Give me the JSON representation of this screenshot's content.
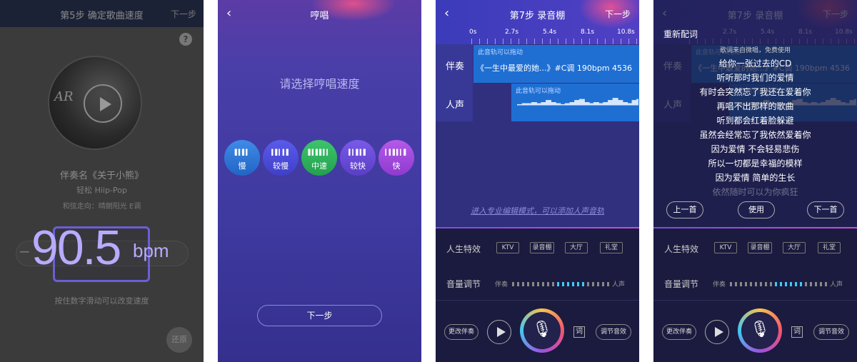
{
  "screen1": {
    "title": "第5步 确定歌曲速度",
    "next": "下一步",
    "help": "?",
    "cover_text": "AR",
    "song_name": "伴奏名《关于小熊》",
    "style": "轻松 Hiip-Pop",
    "chord": "和弦走向：晴朗阳光   E调",
    "bpm_value": "90.5",
    "bpm_unit": "bpm",
    "minus": "−",
    "hint": "按住数字滑动可以改变速度",
    "confirm": "还原"
  },
  "screen2": {
    "title": "哼唱",
    "back_icon": "chevron-left-icon",
    "prompt": "请选择哼唱速度",
    "speeds": [
      {
        "label": "慢",
        "colors": [
          "#3f8be8",
          "#2265c4"
        ]
      },
      {
        "label": "较慢",
        "colors": [
          "#5a5bea",
          "#3f3fc8"
        ]
      },
      {
        "label": "中速",
        "colors": [
          "#3ec46c",
          "#23a04e"
        ]
      },
      {
        "label": "较快",
        "colors": [
          "#7a5ae8",
          "#5a3ec6"
        ]
      },
      {
        "label": "快",
        "colors": [
          "#b45ae8",
          "#8f3ad0"
        ]
      }
    ],
    "next_button": "下一步"
  },
  "studio": {
    "title": "第7步 录音棚",
    "next": "下一步",
    "ticks": [
      "0s",
      "2.7s",
      "5.4s",
      "8.1s",
      "10.8s"
    ],
    "accompaniment_label": "伴奏",
    "vocal_label": "人声",
    "drag_hint": "此音轨可以拖动",
    "accompaniment_text": "《一生中最爱的她...》#C调 190bpm 4536",
    "pro_edit": "进入专业编辑模式，可以添加人声音轨",
    "effects_label": "人生特效",
    "effects": [
      "KTV",
      "录音棚",
      "大厅",
      "礼堂"
    ],
    "volume_label": "音量调节",
    "vol_left": "伴奏",
    "vol_right": "人声",
    "change_accompaniment": "更改伴奏",
    "lyrics_icon": "词",
    "adjust_effect": "调节音效"
  },
  "lyrics_screen": {
    "redo_lyrics": "重新配词",
    "source": "歌词来自微唱，免费使用",
    "lines": [
      "给你一张过去的CD",
      "听听那时我们的爱情",
      "有时会突然忘了我还在爱着你",
      "再唱不出那样的歌曲",
      "听到都会红着脸躲避",
      "虽然会经常忘了我依然爱着你",
      "因为爱情 不会轻易悲伤",
      "所以一切都是幸福的模样",
      "因为爱情 简单的生长",
      "依然随时可以为你疯狂"
    ],
    "prev": "上一首",
    "use": "使用",
    "next": "下一首"
  }
}
